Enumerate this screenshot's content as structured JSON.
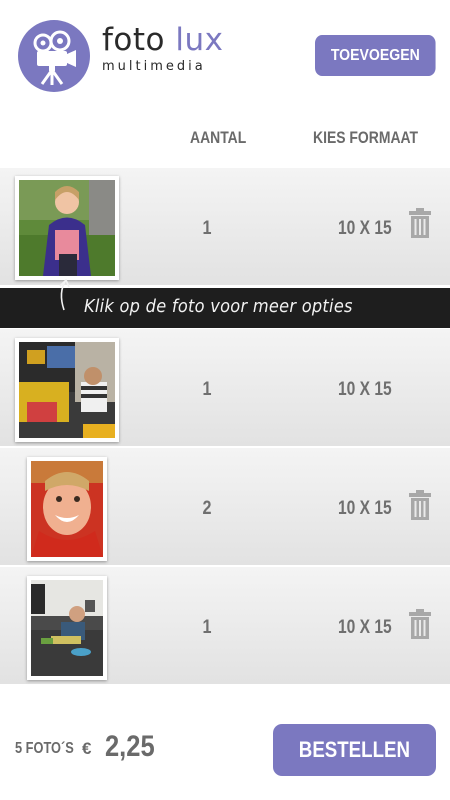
{
  "header": {
    "brand_main": "foto",
    "brand_accent": "lux",
    "brand_sub": "multimedia",
    "add_button": "TOEVOEGEN",
    "logo_icon": "film-camera-icon"
  },
  "columns": {
    "quantity": "AANTAL",
    "format": "KIES FORMAAT"
  },
  "tooltip": "Klik op de foto voor meer opties",
  "rows": [
    {
      "quantity": "1",
      "format": "10 X 15",
      "photo": "girl-in-garden-photo",
      "show_trash": true
    },
    {
      "quantity": "1",
      "format": "10 X 15",
      "photo": "child-at-arcade-photo",
      "show_trash": false
    },
    {
      "quantity": "2",
      "format": "10 X 15",
      "photo": "child-face-red-hood-photo",
      "show_trash": true
    },
    {
      "quantity": "1",
      "format": "10 X 15",
      "photo": "child-on-couch-photo",
      "show_trash": true
    }
  ],
  "footer": {
    "count_label": "5 FOTO´S",
    "currency": "€",
    "total": "2,25",
    "order_button": "BESTELLEN"
  },
  "colors": {
    "accent": "#7b78c0",
    "text_gray": "#6f6f6f",
    "tip_band": "#1e1e1e"
  }
}
